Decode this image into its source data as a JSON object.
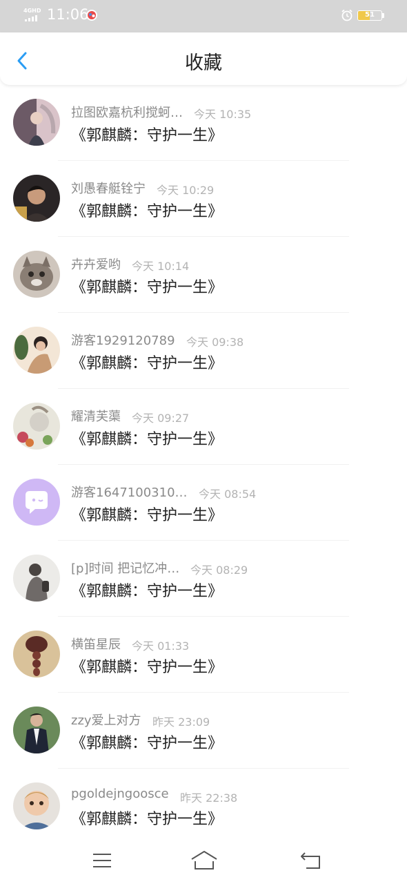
{
  "status_bar": {
    "network": "4GHD",
    "time": "11:06",
    "battery": "51",
    "battery_level": 0.51
  },
  "nav": {
    "title": "收藏",
    "back_icon": "chevron-left-icon",
    "accent_color": "#2a9df4"
  },
  "favorites": [
    {
      "name": "拉图欧嘉杭利搅蚵…",
      "time": "今天 10:35",
      "title": "《郭麒麟：守护一生》",
      "avatar": "photo-girl-pink-background"
    },
    {
      "name": "刘愚春艇铨宁",
      "time": "今天 10:29",
      "title": "《郭麒麟：守护一生》",
      "avatar": "photo-boy-portrait"
    },
    {
      "name": "卉卉爱哟",
      "time": "今天 10:14",
      "title": "《郭麒麟：守护一生》",
      "avatar": "photo-cat"
    },
    {
      "name": "游客1929120789",
      "time": "今天 09:38",
      "title": "《郭麒麟：守护一生》",
      "avatar": "photo-girl-light-background"
    },
    {
      "name": "耀清芙蕖",
      "time": "今天 09:27",
      "title": "《郭麒麟：守护一生》",
      "avatar": "illustration-anime-flowers"
    },
    {
      "name": "游客1647100310…",
      "time": "今天 08:54",
      "title": "《郭麒麟：守护一生》",
      "avatar": "default-chat-bubble-avatar"
    },
    {
      "name": "[p]时间 把记忆冲…",
      "time": "今天 08:29",
      "title": "《郭麒麟：守护一生》",
      "avatar": "illustration-person-back"
    },
    {
      "name": "横笛星辰",
      "time": "今天 01:33",
      "title": "《郭麒麟：守护一生》",
      "avatar": "photo-braid-hair"
    },
    {
      "name": "zzy爱上对方",
      "time": "昨天 23:09",
      "title": "《郭麒麟：守护一生》",
      "avatar": "photo-man-suit"
    },
    {
      "name": "pgoldejngoosce",
      "time": "昨天 22:38",
      "title": "《郭麒麟：守护一生》",
      "avatar": "photo-child-face"
    }
  ],
  "bottom_nav": {
    "menu_icon": "menu-icon",
    "home_icon": "home-icon",
    "back_icon": "back-arrow-icon"
  }
}
